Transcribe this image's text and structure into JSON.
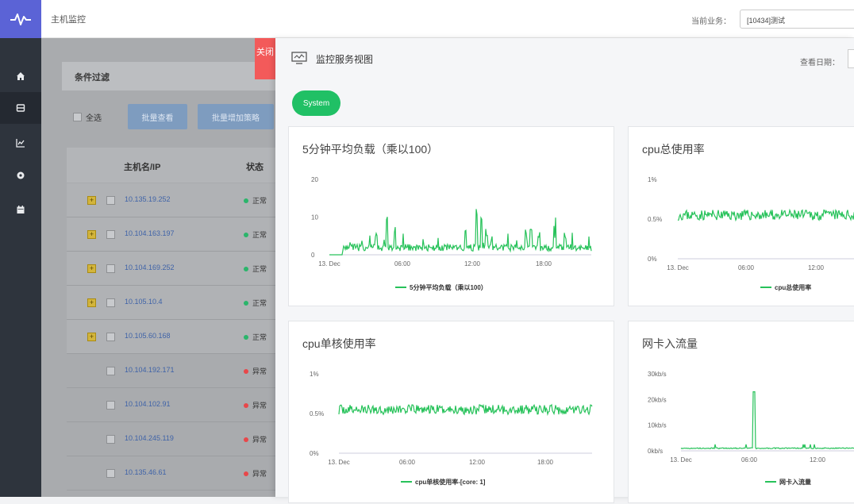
{
  "header": {
    "app_title": "主机监控",
    "business_label": "当前业务：",
    "business_value": "[10434]测试"
  },
  "sidebar": {
    "items": [
      {
        "icon": "home-icon"
      },
      {
        "icon": "database-icon"
      },
      {
        "icon": "chart-icon"
      },
      {
        "icon": "gear-icon"
      },
      {
        "icon": "calendar-icon"
      }
    ]
  },
  "filter": {
    "title": "条件过滤",
    "select_all": "全选",
    "batch_view": "批量查看",
    "batch_add_strategy": "批量增加策略"
  },
  "table": {
    "col_host": "主机名/IP",
    "col_status": "状态",
    "rows": [
      {
        "ip": "10.135.19.252",
        "status": "正常",
        "ok": true,
        "expand": true
      },
      {
        "ip": "10.104.163.197",
        "status": "正常",
        "ok": true,
        "expand": true
      },
      {
        "ip": "10.104.169.252",
        "status": "正常",
        "ok": true,
        "expand": true
      },
      {
        "ip": "10.105.10.4",
        "status": "正常",
        "ok": true,
        "expand": true
      },
      {
        "ip": "10.105.60.168",
        "status": "正常",
        "ok": true,
        "expand": true
      },
      {
        "ip": "10.104.192.171",
        "status": "异常",
        "ok": false,
        "expand": false
      },
      {
        "ip": "10.104.102.91",
        "status": "异常",
        "ok": false,
        "expand": false
      },
      {
        "ip": "10.104.245.119",
        "status": "异常",
        "ok": false,
        "expand": false
      },
      {
        "ip": "10.135.46.61",
        "status": "异常",
        "ok": false,
        "expand": false
      }
    ]
  },
  "panel": {
    "close_label": "关闭",
    "title": "监控服务视图",
    "date_label": "查看日期：",
    "tab_system": "System"
  },
  "colors": {
    "accent_green": "#20c065",
    "ok_green": "#2bb56b",
    "error_red": "#e8474a",
    "line_green": "#27c25a",
    "sidebar_bg": "#2e343d",
    "logo_bg": "#5b63d6"
  },
  "chart_data": [
    {
      "type": "line",
      "title": "5分钟平均负载（乘以100）",
      "y_ticks": [
        "0",
        "10",
        "20"
      ],
      "ylim": [
        0,
        20
      ],
      "x_ticks": [
        "13. Dec",
        "06:00",
        "12:00",
        "18:00"
      ],
      "series": [
        {
          "name": "5分钟平均负载（乘以100）"
        }
      ],
      "pattern": "spiky baseline ~1-3 with spikes up to ~14"
    },
    {
      "type": "line",
      "title": "cpu总使用率",
      "y_ticks": [
        "0%",
        "0.5%",
        "1%"
      ],
      "ylim": [
        0,
        1
      ],
      "x_ticks": [
        "13. Dec",
        "06:00",
        "12:00"
      ],
      "series": [
        {
          "name": "cpu总使用率"
        }
      ],
      "pattern": "noisy around 0.5%"
    },
    {
      "type": "line",
      "title": "cpu单核使用率",
      "y_ticks": [
        "0%",
        "0.5%",
        "1%"
      ],
      "ylim": [
        0,
        1
      ],
      "x_ticks": [
        "13. Dec",
        "06:00",
        "12:00",
        "18:00"
      ],
      "series": [
        {
          "name": "cpu单核使用率-[core: 1]"
        }
      ],
      "pattern": "noisy around 0.5%"
    },
    {
      "type": "line",
      "title": "网卡入流量",
      "y_ticks": [
        "0kb/s",
        "10kb/s",
        "20kb/s",
        "30kb/s"
      ],
      "ylim": [
        0,
        30
      ],
      "x_ticks": [
        "13. Dec",
        "06:00",
        "12:00"
      ],
      "series": [
        {
          "name": "网卡入流量"
        }
      ],
      "pattern": "flat ~1 with spike to ~23 near 06:30"
    }
  ]
}
